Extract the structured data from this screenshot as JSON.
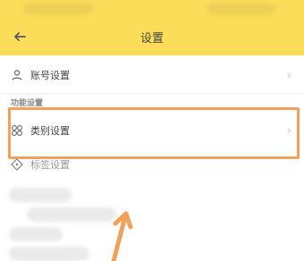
{
  "header": {
    "title": "设置",
    "back_icon": "arrow-left-icon",
    "bg_color": "#fbdd5a"
  },
  "settings": {
    "account": {
      "label": "账号设置",
      "icon": "user-icon"
    },
    "section_title": "功能设置",
    "category": {
      "label": "类别设置",
      "icon": "grid-icon"
    },
    "tags": {
      "label": "标签设置",
      "icon": "tag-icon"
    }
  },
  "annotation": {
    "highlight_color": "#f0a15a"
  }
}
